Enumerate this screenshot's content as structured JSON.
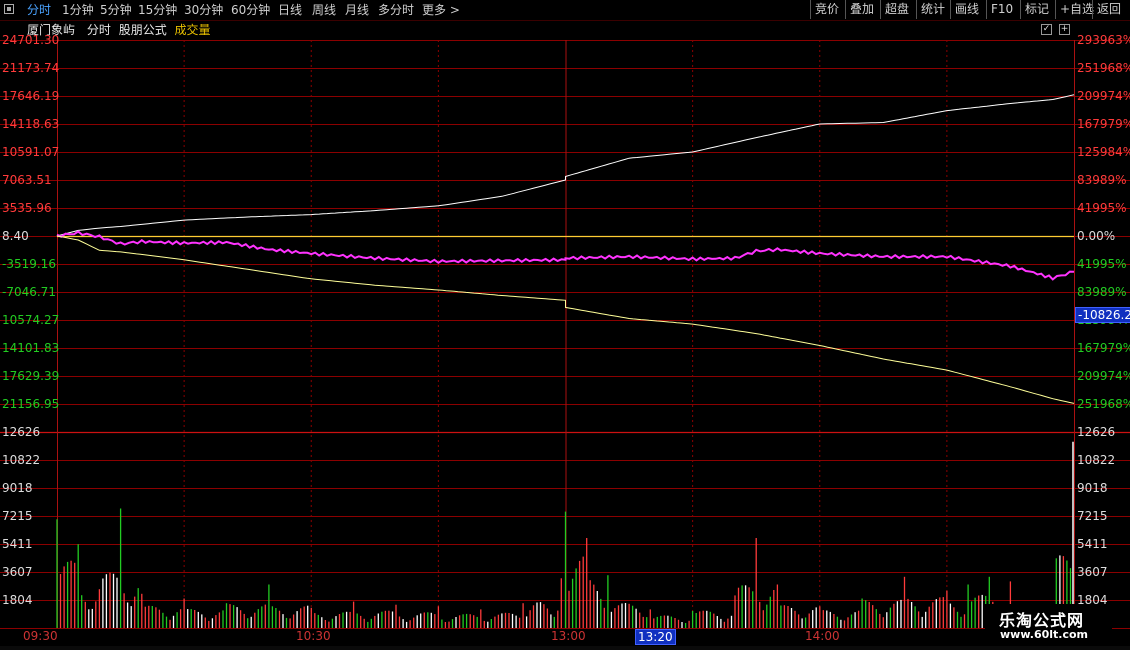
{
  "toolbar": {
    "periods": [
      "分时",
      "1分钟",
      "5分钟",
      "15分钟",
      "30分钟",
      "60分钟",
      "日线",
      "周线",
      "月线",
      "多分时",
      "更多 >"
    ],
    "active_index": 0,
    "right_buttons": [
      "竞价",
      "叠加",
      "超盘",
      "统计",
      "画线",
      "F10",
      "标记",
      "+自选",
      "返回"
    ]
  },
  "info": {
    "name": "厦门象屿",
    "mode": "分时",
    "formula": "股朋公式",
    "volume_label": "成交量"
  },
  "colors": {
    "background": "#000000",
    "grid": "#8b0000",
    "up": "#ff3b3b",
    "down": "#22cc22",
    "upper_line": "#ffffff",
    "lower_line": "#ffff99",
    "middle_line": "#ff33ff",
    "zero_line": "#ffcc33",
    "active_tab": "#4aa3ff"
  },
  "chart_data": {
    "type": "line",
    "title": "厦门象屿",
    "x_range": [
      "09:30",
      "15:00"
    ],
    "left_ticks": [
      "24701.30",
      "21173.74",
      "17646.19",
      "14118.63",
      "10591.07",
      "7063.51",
      "3535.96",
      "8.40",
      "-3519.16",
      "-7046.71",
      "10574.27",
      "14101.83",
      "17629.39",
      "21156.95",
      "12626"
    ],
    "right_ticks": [
      "293963%",
      "251968%",
      "209974%",
      "167979%",
      "125984%",
      "83989%",
      "41995%",
      "0.00%",
      "41995%",
      "83989%",
      "125984%",
      "167979%",
      "209974%",
      "251968%",
      "12626"
    ],
    "ylim": [
      -21156.95,
      24701.3
    ],
    "current_value_label": "-10826.2",
    "series": [
      {
        "color": "#ffffff",
        "points": [
          [
            "09:30",
            8.4
          ],
          [
            "09:35",
            700
          ],
          [
            "09:40",
            1000
          ],
          [
            "09:45",
            1200
          ],
          [
            "10:00",
            2000
          ],
          [
            "10:15",
            2400
          ],
          [
            "10:30",
            2700
          ],
          [
            "10:45",
            3200
          ],
          [
            "11:00",
            3800
          ],
          [
            "11:15",
            5000
          ],
          [
            "11:30",
            7063
          ],
          [
            "13:00",
            7500
          ],
          [
            "13:15",
            9800
          ],
          [
            "13:30",
            10591
          ],
          [
            "13:45",
            12400
          ],
          [
            "14:00",
            14118
          ],
          [
            "14:15",
            14300
          ],
          [
            "14:30",
            15800
          ],
          [
            "14:45",
            16700
          ],
          [
            "14:55",
            17200
          ],
          [
            "15:00",
            17800
          ]
        ]
      },
      {
        "color": "#ff33ff",
        "points": [
          [
            "09:30",
            8.4
          ],
          [
            "09:35",
            400
          ],
          [
            "09:40",
            -100
          ],
          [
            "09:45",
            -1000
          ],
          [
            "09:50",
            -700
          ],
          [
            "10:00",
            -900
          ],
          [
            "10:10",
            -800
          ],
          [
            "10:20",
            -1700
          ],
          [
            "10:30",
            -2200
          ],
          [
            "10:45",
            -2800
          ],
          [
            "11:00",
            -3200
          ],
          [
            "11:15",
            -3100
          ],
          [
            "11:30",
            -3000
          ],
          [
            "13:00",
            -2800
          ],
          [
            "13:15",
            -2600
          ],
          [
            "13:30",
            -2900
          ],
          [
            "13:40",
            -2800
          ],
          [
            "13:45",
            -1900
          ],
          [
            "13:50",
            -1700
          ],
          [
            "14:00",
            -2200
          ],
          [
            "14:15",
            -2600
          ],
          [
            "14:30",
            -2600
          ],
          [
            "14:45",
            -3800
          ],
          [
            "14:55",
            -5300
          ],
          [
            "15:00",
            -4500
          ]
        ]
      },
      {
        "color": "#ffff99",
        "points": [
          [
            "09:30",
            8.4
          ],
          [
            "09:35",
            -500
          ],
          [
            "09:40",
            -1800
          ],
          [
            "09:45",
            -2000
          ],
          [
            "10:00",
            -3000
          ],
          [
            "10:15",
            -4200
          ],
          [
            "10:30",
            -5400
          ],
          [
            "10:45",
            -6200
          ],
          [
            "11:00",
            -6800
          ],
          [
            "11:15",
            -7500
          ],
          [
            "11:30",
            -8100
          ],
          [
            "13:00",
            -9000
          ],
          [
            "13:15",
            -10400
          ],
          [
            "13:30",
            -11100
          ],
          [
            "13:45",
            -12300
          ],
          [
            "14:00",
            -13800
          ],
          [
            "14:15",
            -15500
          ],
          [
            "14:30",
            -16900
          ],
          [
            "14:45",
            -19000
          ],
          [
            "14:55",
            -20500
          ],
          [
            "15:00",
            -21100
          ]
        ]
      }
    ],
    "volume": {
      "ticks": [
        "12626",
        "10822",
        "9018",
        "7215",
        "5411",
        "3607",
        "1804"
      ],
      "ylim": [
        0,
        12626
      ],
      "bars": [
        [
          "09:30",
          7000,
          "down"
        ],
        [
          "09:35",
          5400,
          "down"
        ],
        [
          "09:40",
          2500,
          "up"
        ],
        [
          "09:45",
          7700,
          "down"
        ],
        [
          "09:50",
          2200,
          "up"
        ],
        [
          "10:00",
          1900,
          "up"
        ],
        [
          "10:10",
          1600,
          "down"
        ],
        [
          "10:20",
          2800,
          "down"
        ],
        [
          "10:30",
          1300,
          "up"
        ],
        [
          "10:40",
          1700,
          "up"
        ],
        [
          "10:50",
          1500,
          "up"
        ],
        [
          "11:00",
          1400,
          "up"
        ],
        [
          "11:10",
          1200,
          "up"
        ],
        [
          "11:20",
          1600,
          "up"
        ],
        [
          "11:29",
          3200,
          "up"
        ],
        [
          "13:00",
          7500,
          "down"
        ],
        [
          "13:05",
          5800,
          "up"
        ],
        [
          "13:10",
          3400,
          "down"
        ],
        [
          "13:20",
          1200,
          "up"
        ],
        [
          "13:30",
          1100,
          "down"
        ],
        [
          "13:40",
          2100,
          "up"
        ],
        [
          "13:45",
          5800,
          "up"
        ],
        [
          "13:50",
          2800,
          "up"
        ],
        [
          "14:00",
          1400,
          "up"
        ],
        [
          "14:10",
          1900,
          "down"
        ],
        [
          "14:20",
          3300,
          "up"
        ],
        [
          "14:30",
          2400,
          "up"
        ],
        [
          "14:35",
          2800,
          "down"
        ],
        [
          "14:40",
          3300,
          "down"
        ],
        [
          "14:45",
          3000,
          "up"
        ],
        [
          "14:50",
          1200,
          "up"
        ],
        [
          "14:55",
          1400,
          "up"
        ],
        [
          "15:00",
          12000,
          "up"
        ]
      ]
    },
    "time_ticks": [
      "09:30",
      "10:30",
      "13:00",
      "13:20",
      "14:00"
    ],
    "highlight_time": "13:20"
  },
  "watermark": {
    "title": "乐淘公式网",
    "url": "www.60lt.com"
  }
}
